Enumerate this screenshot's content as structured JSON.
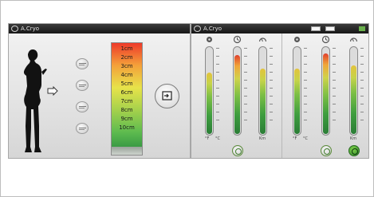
{
  "left_screen": {
    "title": "A.Cryo",
    "depth_scale": [
      "1cm",
      "2cm",
      "3cm",
      "4cm",
      "5cm",
      "6cm",
      "7cm",
      "8cm",
      "9cm",
      "10cm"
    ],
    "position_buttons": 4
  },
  "right_screen": {
    "title": "A.Cryo",
    "panels": [
      {
        "icons": [
          "gear-icon",
          "clock-icon",
          "gauge-icon"
        ],
        "gauges": [
          0.7,
          0.9,
          0.75
        ],
        "labels": [
          "°F",
          "°C",
          "Km"
        ],
        "button": "power-button"
      },
      {
        "icons": [
          "gear-icon",
          "clock-icon",
          "gauge-icon"
        ],
        "gauges": [
          0.75,
          0.92,
          0.78
        ],
        "labels": [
          "°F",
          "°C",
          "Km"
        ],
        "button": "start-button"
      }
    ]
  },
  "colors": {
    "scale_top": "#ee3a2a",
    "scale_bottom": "#3a9a44",
    "accent_green": "#3f9e3f",
    "titlebar": "#1e1e1e"
  }
}
